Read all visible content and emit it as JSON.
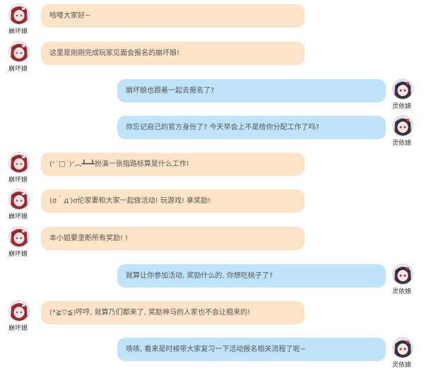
{
  "participants": {
    "bh": {
      "name": "崩坏娘",
      "icon": "avatar-red-hair-icon"
    },
    "ly": {
      "name": "灵依娘",
      "icon": "avatar-dark-hair-icon"
    }
  },
  "messages": [
    {
      "side": "left",
      "name": "崩坏娘",
      "text": "哈喽大家好~"
    },
    {
      "side": "left",
      "name": "崩坏娘",
      "text": "这里是刚刚完成玩家见面会报名的崩坏娘!"
    },
    {
      "side": "right",
      "name": "灵依娘",
      "text": "崩坏娘也跟着一起去报名了?"
    },
    {
      "side": "right",
      "name": "灵依娘",
      "text": "你忘记自己的官方身份了? 今天早会上不是给你分配工作了吗?"
    },
    {
      "side": "left",
      "name": "崩坏娘",
      "text": "(ᐟ˙□˙)ᐟ︵┻━┻扮演一张指路标算是什么工作!"
    },
    {
      "side": "left",
      "name": "崩坏娘",
      "text": "(σ｀д′)σ伦家要和大家一起做活动! 玩游戏! 拿奖励!"
    },
    {
      "side": "left",
      "name": "崩坏娘",
      "text": "本小姐要垄断所有奖励! !"
    },
    {
      "side": "right",
      "name": "灵依娘",
      "text": "就算让你参加活动, 奖励什么的, 你想吃桃子了?"
    },
    {
      "side": "left",
      "name": "崩坏娘",
      "text": "(*≧▽≦)哼哼, 就算乃们都来了, 奖励神马的人家也不会让粗来的!"
    },
    {
      "side": "right",
      "name": "灵依娘",
      "text": "咳咳, 看来是时候带大家复习一下活动报名相关流程了呢~"
    }
  ]
}
